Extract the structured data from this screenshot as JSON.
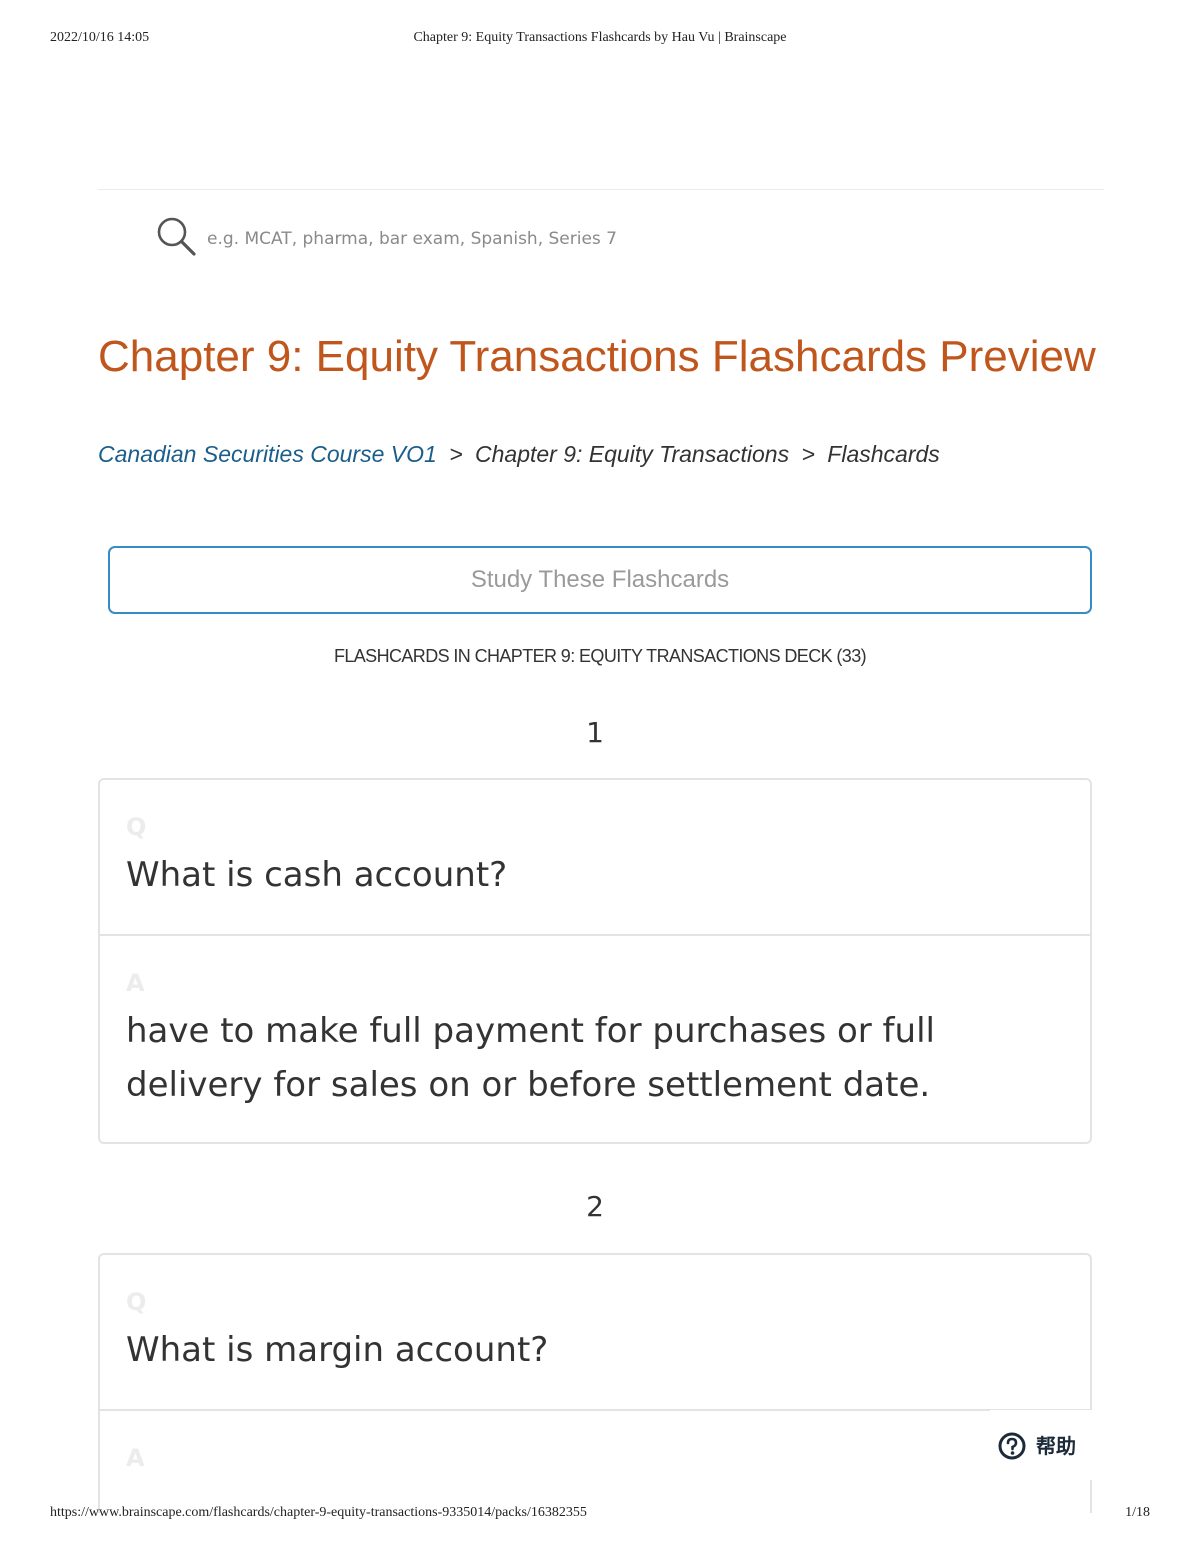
{
  "print_header": {
    "datetime": "2022/10/16 14:05",
    "document_title": "Chapter 9: Equity Transactions Flashcards by Hau Vu | Brainscape"
  },
  "search": {
    "placeholder": "e.g. MCAT, pharma, bar exam, Spanish, Series 7",
    "icon": "search-icon"
  },
  "page": {
    "title": "Chapter 9: Equity Transactions Flashcards Preview"
  },
  "breadcrumb": {
    "items": [
      "Canadian Securities Course VO1",
      "Chapter 9: Equity Transactions",
      "Flashcards"
    ],
    "separator": ">"
  },
  "study_button": {
    "label": "Study These Flashcards"
  },
  "deck": {
    "heading": "FLASHCARDS IN CHAPTER 9: EQUITY TRANSACTIONS DECK (33)"
  },
  "cards": [
    {
      "number": "1",
      "q_label": "Q",
      "question": "What is cash account?",
      "a_label": "A",
      "answer": "have to make full payment for purchases or full delivery for sales on or before settlement date."
    },
    {
      "number": "2",
      "q_label": "Q",
      "question": "What is margin account?",
      "a_label": "A",
      "answer": ""
    }
  ],
  "help": {
    "label": "帮助",
    "icon": "question-circle-icon"
  },
  "print_footer": {
    "url": "https://www.brainscape.com/flashcards/chapter-9-equity-transactions-9335014/packs/16382355",
    "page_indicator": "1/18"
  },
  "colors": {
    "title": "#c0561c",
    "link": "#1b5e8c",
    "button_border": "#3a8ac5",
    "card_border": "#e3e3e3"
  }
}
